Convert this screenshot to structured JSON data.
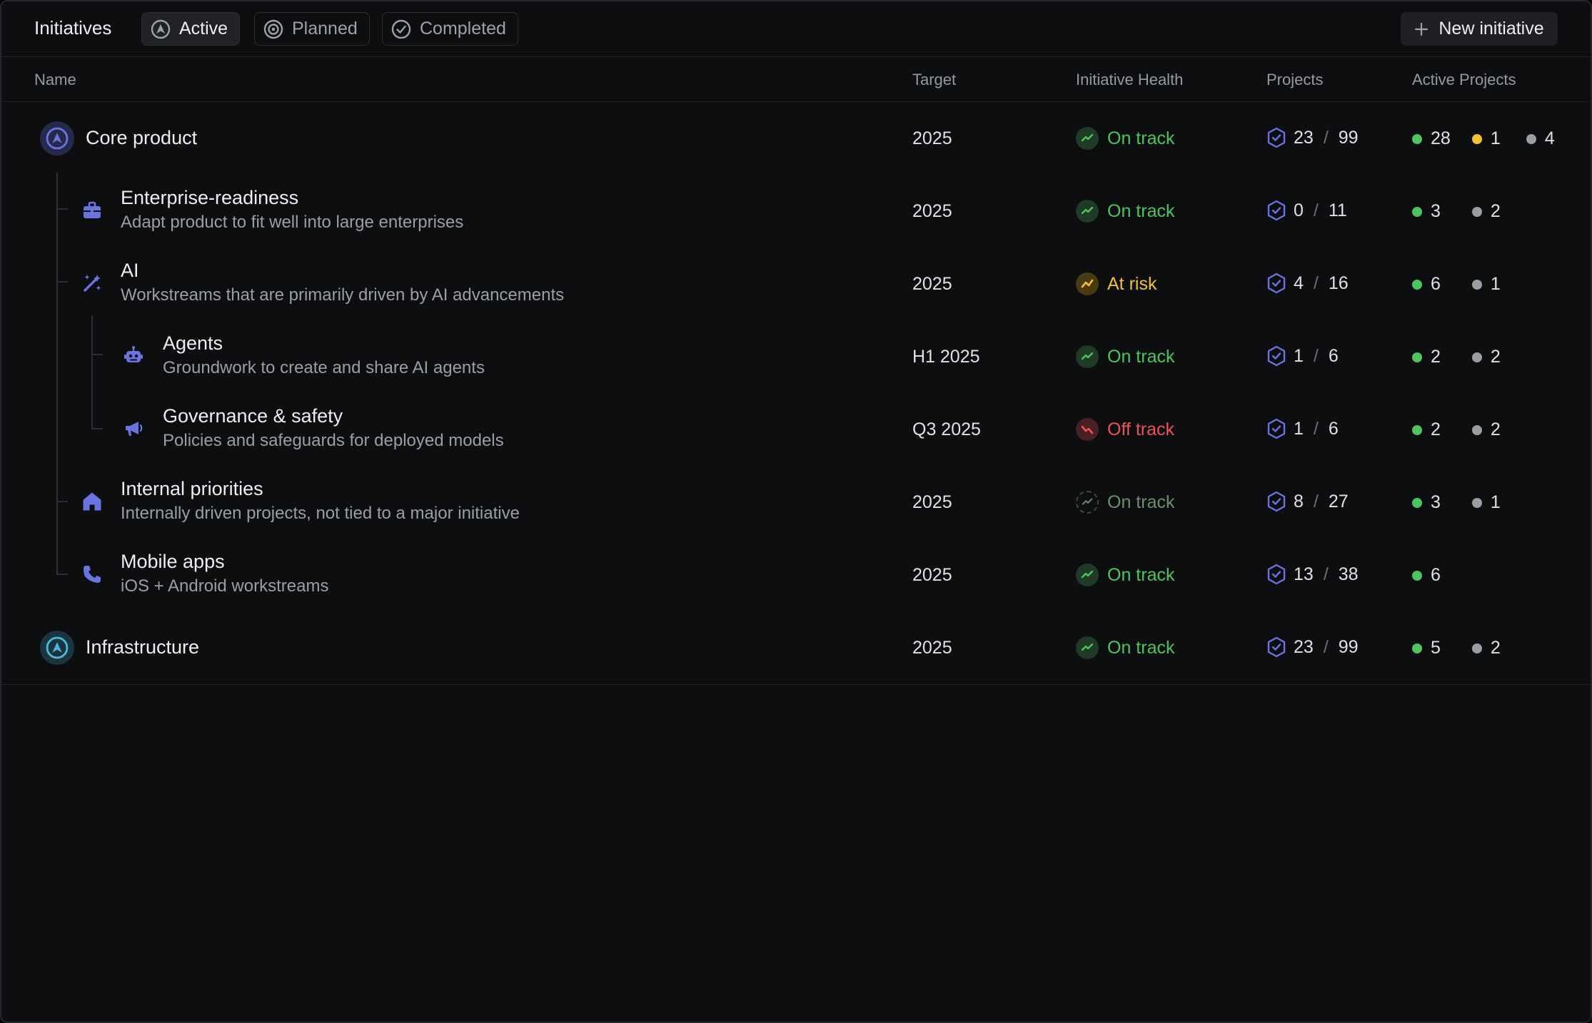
{
  "header": {
    "title": "Initiatives",
    "tabs": [
      {
        "label": "Active",
        "icon": "rocket-circle-icon"
      },
      {
        "label": "Planned",
        "icon": "target-icon"
      },
      {
        "label": "Completed",
        "icon": "check-circle-icon"
      }
    ],
    "new_button": "New initiative"
  },
  "columns": {
    "name": "Name",
    "target": "Target",
    "health": "Initiative Health",
    "projects": "Projects",
    "active": "Active Projects"
  },
  "colors": {
    "green": "#4cc560",
    "yellow": "#f2c230",
    "red": "#ec5454",
    "gray": "#9a9ea5",
    "accent": "#5e6ad2",
    "muted_green": "#6b8f6f"
  },
  "rows": [
    {
      "name": "Core product",
      "desc": "",
      "target": "2025",
      "health": "On track",
      "projects_done": "23",
      "projects_total": "99",
      "active_green": "28",
      "active_yellow": "1",
      "active_gray": "4",
      "icon": "rocket-circle-icon"
    },
    {
      "name": "Enterprise-readiness",
      "desc": "Adapt product to fit well into large enterprises",
      "target": "2025",
      "health": "On track",
      "projects_done": "0",
      "projects_total": "11",
      "active_green": "3",
      "active_gray": "2",
      "icon": "briefcase-icon"
    },
    {
      "name": "AI",
      "desc": "Workstreams that are primarily driven by AI advancements",
      "target": "2025",
      "health": "At risk",
      "projects_done": "4",
      "projects_total": "16",
      "active_green": "6",
      "active_gray": "1",
      "icon": "magic-wand-icon"
    },
    {
      "name": "Agents",
      "desc": "Groundwork to create and share AI agents",
      "target": "H1 2025",
      "health": "On track",
      "projects_done": "1",
      "projects_total": "6",
      "active_green": "2",
      "active_gray": "2",
      "icon": "robot-icon"
    },
    {
      "name": "Governance & safety",
      "desc": "Policies and safeguards for deployed models",
      "target": "Q3 2025",
      "health": "Off track",
      "projects_done": "1",
      "projects_total": "6",
      "active_green": "2",
      "active_gray": "2",
      "icon": "megaphone-icon"
    },
    {
      "name": "Internal priorities",
      "desc": "Internally driven projects, not tied to a major initiative",
      "target": "2025",
      "health": "On track",
      "projects_done": "8",
      "projects_total": "27",
      "active_green": "3",
      "active_gray": "1",
      "icon": "house-icon"
    },
    {
      "name": "Mobile apps",
      "desc": "iOS + Android workstreams",
      "target": "2025",
      "health": "On track",
      "projects_done": "13",
      "projects_total": "38",
      "active_green": "6",
      "icon": "phone-icon"
    },
    {
      "name": "Infrastructure",
      "desc": "",
      "target": "2025",
      "health": "On track",
      "projects_done": "23",
      "projects_total": "99",
      "active_green": "5",
      "active_gray": "2",
      "icon": "rocket-circle-icon"
    }
  ]
}
